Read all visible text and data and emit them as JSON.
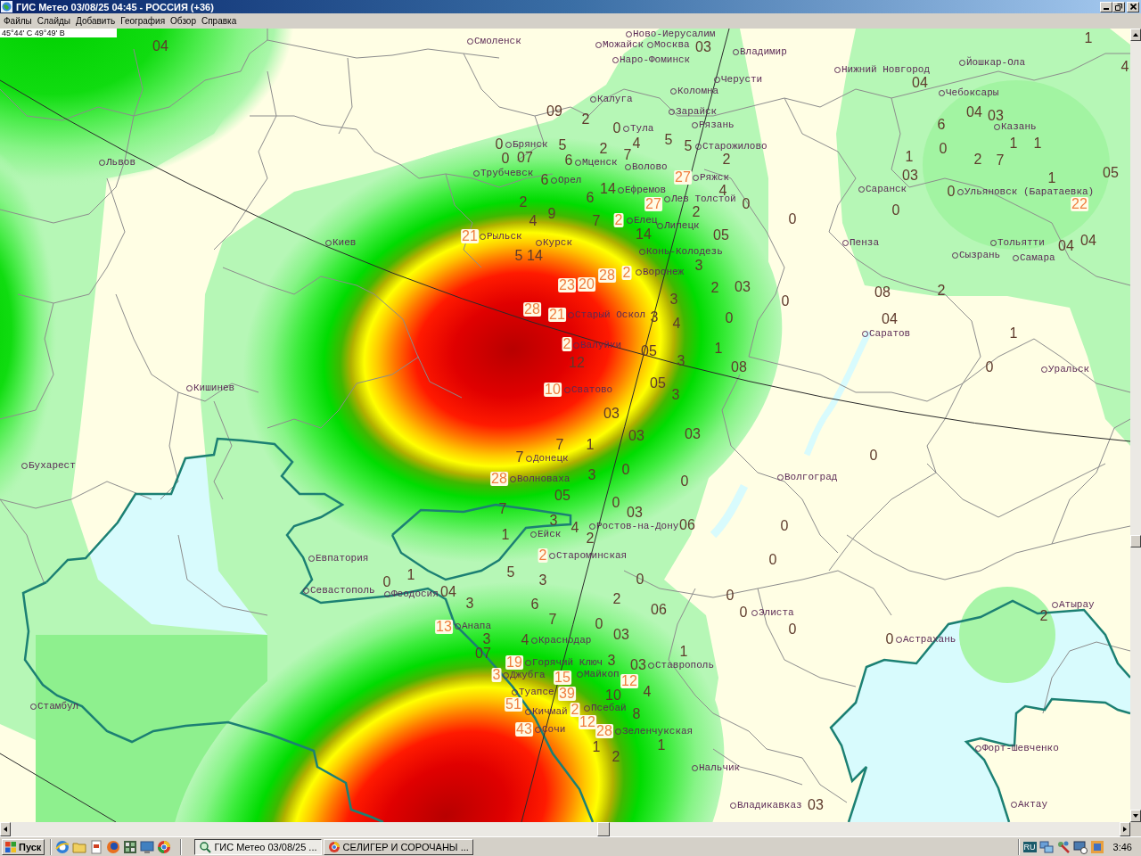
{
  "window": {
    "title": "ГИС Метео 03/08/25 04:45 - РОССИЯ (+36)"
  },
  "menu": [
    "Файлы",
    "Слайды",
    "Добавить",
    "География",
    "Обзор",
    "Справка"
  ],
  "coordinates": "45°44' С 49°49' В",
  "map": {
    "cities": [
      "Ново-Иерусалим",
      "Смоленск",
      "Можайск",
      "Москва",
      "Владимир",
      "Наро-Фоминск",
      "Йошкар-Ола",
      "Нижний Новгород",
      "Черусти",
      "Коломна",
      "Чебоксары",
      "Калуга",
      "Зарайск",
      "Тула",
      "Рязань",
      "Казань",
      "Брянск",
      "Старожилово",
      "Львов",
      "Мценск",
      "Волово",
      "Трубчевск",
      "Орел",
      "Ряжск",
      "Ефремов",
      "Саранск",
      "Ульяновск (Баратаевка)",
      "Лев Толстой",
      "Елец",
      "Липецк",
      "Киев",
      "Рыльск",
      "Курск",
      "Пенза",
      "Тольятти",
      "Конь-Колодезь",
      "Сызрань",
      "Самара",
      "Воронеж",
      "Старый Оскол",
      "Саратов",
      "Валуйки",
      "Уральск",
      "Кишинев",
      "Сватово",
      "Бухарест",
      "Донецк",
      "Волноваха",
      "Волгоград",
      "Ейск",
      "Ростов-на-Дону",
      "Евпатория",
      "Староминская",
      "Севастополь",
      "Феодосия",
      "Элиста",
      "Атырау",
      "Анапа",
      "Краснодар",
      "Астрахань",
      "Горячий Ключ",
      "Ставрополь",
      "Джубга",
      "Майкоп",
      "Туапсе",
      "Стамбул",
      "Кичмай",
      "Псебай",
      "Сочи",
      "Зеленчукская",
      "Форт-Шевченко",
      "Нальчик",
      "Владикавказ",
      "Актау"
    ],
    "values": [
      {
        "text": "1",
        "color": "#5e3a2c"
      },
      {
        "text": "04",
        "color": "#5e3a2c"
      },
      {
        "text": "03",
        "color": "#5e3a2c"
      },
      {
        "text": "4",
        "color": "#5e3a2c"
      },
      {
        "text": "04",
        "color": "#5e3a2c"
      },
      {
        "text": "09",
        "color": "#5e3a2c"
      },
      {
        "text": "2",
        "color": "#5e3a2c"
      },
      {
        "text": "04",
        "color": "#5e3a2c"
      },
      {
        "text": "03",
        "color": "#5e3a2c"
      },
      {
        "text": "0",
        "color": "#5e3a2c"
      },
      {
        "text": "6",
        "color": "#5e3a2c"
      },
      {
        "text": "0",
        "color": "#5e3a2c"
      },
      {
        "text": "5",
        "color": "#5e3a2c"
      },
      {
        "text": "2",
        "color": "#5e3a2c"
      },
      {
        "text": "4",
        "color": "#5e3a2c"
      },
      {
        "text": "5",
        "color": "#5e3a2c"
      },
      {
        "text": "5",
        "color": "#5e3a2c"
      },
      {
        "text": "0",
        "color": "#5e3a2c"
      },
      {
        "text": "1",
        "color": "#5e3a2c"
      },
      {
        "text": "1",
        "color": "#5e3a2c"
      },
      {
        "text": "0",
        "color": "#5e3a2c"
      },
      {
        "text": "07",
        "color": "#5e3a2c"
      },
      {
        "text": "6",
        "color": "#5e3a2c"
      },
      {
        "text": "7",
        "color": "#5e3a2c"
      },
      {
        "text": "2",
        "color": "#5e3a2c"
      },
      {
        "text": "1",
        "color": "#5e3a2c"
      },
      {
        "text": "2",
        "color": "#5e3a2c"
      },
      {
        "text": "7",
        "color": "#5e3a2c"
      },
      {
        "text": "6",
        "color": "#5e3a2c"
      },
      {
        "text": "27",
        "color": "#ef7f3f"
      },
      {
        "text": "03",
        "color": "#5e3a2c"
      },
      {
        "text": "1",
        "color": "#5e3a2c"
      },
      {
        "text": "05",
        "color": "#5e3a2c"
      },
      {
        "text": "14",
        "color": "#5e3a2c"
      },
      {
        "text": "4",
        "color": "#5e3a2c"
      },
      {
        "text": "0",
        "color": "#5e3a2c"
      },
      {
        "text": "2",
        "color": "#5e3a2c"
      },
      {
        "text": "6",
        "color": "#5e3a2c"
      },
      {
        "text": "27",
        "color": "#ef7f3f"
      },
      {
        "text": "0",
        "color": "#5e3a2c"
      },
      {
        "text": "22",
        "color": "#ef7f3f"
      },
      {
        "text": "9",
        "color": "#5e3a2c"
      },
      {
        "text": "2",
        "color": "#5e3a2c"
      },
      {
        "text": "0",
        "color": "#5e3a2c"
      },
      {
        "text": "4",
        "color": "#5e3a2c"
      },
      {
        "text": "7",
        "color": "#5e3a2c"
      },
      {
        "text": "2",
        "color": "#ef7f3f"
      },
      {
        "text": "0",
        "color": "#5e3a2c"
      },
      {
        "text": "21",
        "color": "#ef7f3f"
      },
      {
        "text": "14",
        "color": "#5e3a2c"
      },
      {
        "text": "05",
        "color": "#5e3a2c"
      },
      {
        "text": "04",
        "color": "#5e3a2c"
      },
      {
        "text": "04",
        "color": "#5e3a2c"
      },
      {
        "text": "5",
        "color": "#5e3a2c"
      },
      {
        "text": "14",
        "color": "#5e3a2c"
      },
      {
        "text": "3",
        "color": "#5e3a2c"
      },
      {
        "text": "28",
        "color": "#ef7f3f"
      },
      {
        "text": "2",
        "color": "#ef7f3f"
      },
      {
        "text": "23",
        "color": "#ef7f3f"
      },
      {
        "text": "20",
        "color": "#ef7f3f"
      },
      {
        "text": "2",
        "color": "#5e3a2c"
      },
      {
        "text": "03",
        "color": "#5e3a2c"
      },
      {
        "text": "08",
        "color": "#5e3a2c"
      },
      {
        "text": "2",
        "color": "#5e3a2c"
      },
      {
        "text": "3",
        "color": "#5e3a2c"
      },
      {
        "text": "0",
        "color": "#5e3a2c"
      },
      {
        "text": "28",
        "color": "#ef7f3f"
      },
      {
        "text": "21",
        "color": "#ef7f3f"
      },
      {
        "text": "3",
        "color": "#5e3a2c"
      },
      {
        "text": "4",
        "color": "#5e3a2c"
      },
      {
        "text": "0",
        "color": "#5e3a2c"
      },
      {
        "text": "04",
        "color": "#5e3a2c"
      },
      {
        "text": "1",
        "color": "#5e3a2c"
      },
      {
        "text": "2",
        "color": "#ef7f3f"
      },
      {
        "text": "05",
        "color": "#5e3a2c"
      },
      {
        "text": "1",
        "color": "#5e3a2c"
      },
      {
        "text": "12",
        "color": "#5e3a2c"
      },
      {
        "text": "3",
        "color": "#5e3a2c"
      },
      {
        "text": "08",
        "color": "#5e3a2c"
      },
      {
        "text": "0",
        "color": "#5e3a2c"
      },
      {
        "text": "10",
        "color": "#ef7f3f"
      },
      {
        "text": "05",
        "color": "#5e3a2c"
      },
      {
        "text": "3",
        "color": "#5e3a2c"
      },
      {
        "text": "03",
        "color": "#5e3a2c"
      },
      {
        "text": "03",
        "color": "#5e3a2c"
      },
      {
        "text": "03",
        "color": "#5e3a2c"
      },
      {
        "text": "7",
        "color": "#5e3a2c"
      },
      {
        "text": "1",
        "color": "#5e3a2c"
      },
      {
        "text": "7",
        "color": "#5e3a2c"
      },
      {
        "text": "0",
        "color": "#5e3a2c"
      },
      {
        "text": "0",
        "color": "#5e3a2c"
      },
      {
        "text": "28",
        "color": "#ef7f3f"
      },
      {
        "text": "3",
        "color": "#5e3a2c"
      },
      {
        "text": "0",
        "color": "#5e3a2c"
      },
      {
        "text": "05",
        "color": "#5e3a2c"
      },
      {
        "text": "7",
        "color": "#5e3a2c"
      },
      {
        "text": "0",
        "color": "#5e3a2c"
      },
      {
        "text": "03",
        "color": "#5e3a2c"
      },
      {
        "text": "3",
        "color": "#5e3a2c"
      },
      {
        "text": "4",
        "color": "#5e3a2c"
      },
      {
        "text": "06",
        "color": "#5e3a2c"
      },
      {
        "text": "0",
        "color": "#5e3a2c"
      },
      {
        "text": "1",
        "color": "#5e3a2c"
      },
      {
        "text": "2",
        "color": "#5e3a2c"
      },
      {
        "text": "2",
        "color": "#ef7f3f"
      },
      {
        "text": "0",
        "color": "#5e3a2c"
      },
      {
        "text": "0",
        "color": "#5e3a2c"
      },
      {
        "text": "1",
        "color": "#5e3a2c"
      },
      {
        "text": "5",
        "color": "#5e3a2c"
      },
      {
        "text": "3",
        "color": "#5e3a2c"
      },
      {
        "text": "0",
        "color": "#5e3a2c"
      },
      {
        "text": "04",
        "color": "#5e3a2c"
      },
      {
        "text": "3",
        "color": "#5e3a2c"
      },
      {
        "text": "6",
        "color": "#5e3a2c"
      },
      {
        "text": "2",
        "color": "#5e3a2c"
      },
      {
        "text": "0",
        "color": "#5e3a2c"
      },
      {
        "text": "7",
        "color": "#5e3a2c"
      },
      {
        "text": "06",
        "color": "#5e3a2c"
      },
      {
        "text": "0",
        "color": "#5e3a2c"
      },
      {
        "text": "2",
        "color": "#5e3a2c"
      },
      {
        "text": "13",
        "color": "#ef7f3f"
      },
      {
        "text": "0",
        "color": "#5e3a2c"
      },
      {
        "text": "0",
        "color": "#5e3a2c"
      },
      {
        "text": "3",
        "color": "#5e3a2c"
      },
      {
        "text": "4",
        "color": "#5e3a2c"
      },
      {
        "text": "03",
        "color": "#5e3a2c"
      },
      {
        "text": "0",
        "color": "#5e3a2c"
      },
      {
        "text": "07",
        "color": "#5e3a2c"
      },
      {
        "text": "1",
        "color": "#5e3a2c"
      },
      {
        "text": "19",
        "color": "#ef7f3f"
      },
      {
        "text": "3",
        "color": "#5e3a2c"
      },
      {
        "text": "03",
        "color": "#5e3a2c"
      },
      {
        "text": "3",
        "color": "#ef7f3f"
      },
      {
        "text": "15",
        "color": "#ef7f3f"
      },
      {
        "text": "12",
        "color": "#ef7f3f"
      },
      {
        "text": "39",
        "color": "#ef7f3f"
      },
      {
        "text": "10",
        "color": "#5e3a2c"
      },
      {
        "text": "4",
        "color": "#5e3a2c"
      },
      {
        "text": "51",
        "color": "#ef7f3f"
      },
      {
        "text": "2",
        "color": "#ef7f3f"
      },
      {
        "text": "8",
        "color": "#5e3a2c"
      },
      {
        "text": "43",
        "color": "#ef7f3f"
      },
      {
        "text": "12",
        "color": "#ef7f3f"
      },
      {
        "text": "28",
        "color": "#ef7f3f"
      },
      {
        "text": "1",
        "color": "#5e3a2c"
      },
      {
        "text": "1",
        "color": "#5e3a2c"
      },
      {
        "text": "2",
        "color": "#5e3a2c"
      },
      {
        "text": "03",
        "color": "#5e3a2c"
      }
    ]
  },
  "taskbar": {
    "start": "Пуск",
    "tasks": [
      {
        "title": "ГИС Метео 03/08/25 ...",
        "selected": true
      },
      {
        "title": "СЕЛИГЕР И СОРОЧАНЫ ...",
        "selected": false
      }
    ],
    "language": "RU",
    "clock": "3:46"
  }
}
